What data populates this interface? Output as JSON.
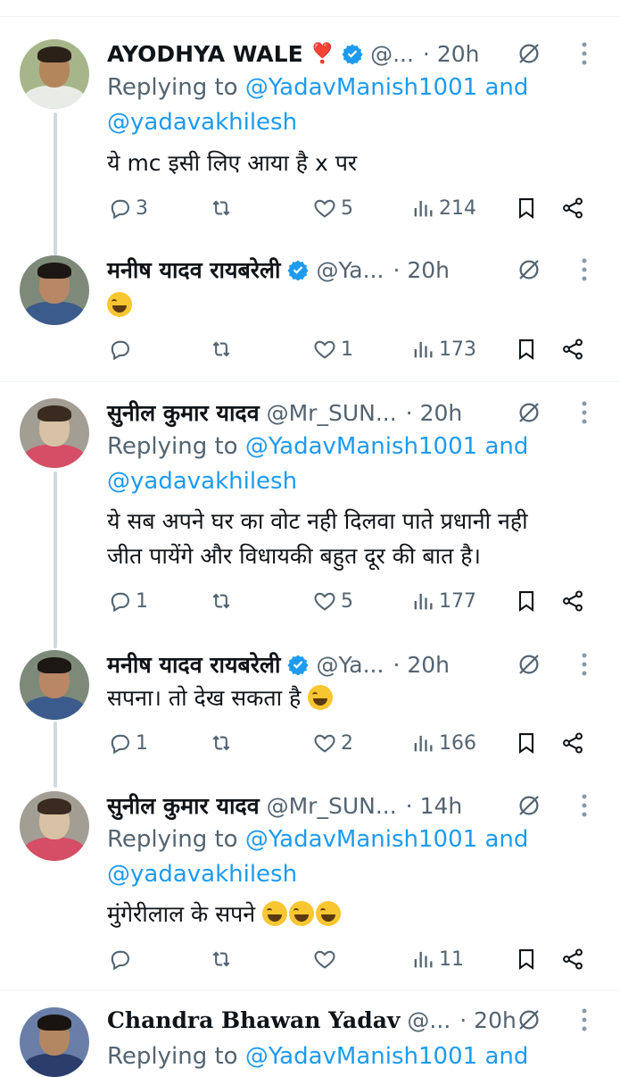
{
  "tweets": [
    {
      "name": "AYODHYA WALE",
      "name_suffix": "❣️",
      "verified": true,
      "handle": "@...",
      "time": "· 20h",
      "replying_prefix": "Replying to ",
      "replying_user1": "@YadavManish1001",
      "replying_and": " and",
      "replying_user2": "@yadavakhilesh",
      "text": "ये mc इसी लिए आया है x पर",
      "replies": "3",
      "retweets": "",
      "likes": "5",
      "views": "214"
    },
    {
      "name": "मनीष यादव रायबरेली",
      "verified": true,
      "handle": "@Ya...",
      "time": "· 20h",
      "text": "",
      "emoji": "laughing-tears",
      "replies": "",
      "retweets": "",
      "likes": "1",
      "views": "173"
    },
    {
      "name": "सुनील कुमार यादव",
      "verified": false,
      "handle": "@Mr_SUN...",
      "time": "· 20h",
      "replying_prefix": "Replying to ",
      "replying_user1": "@YadavManish1001",
      "replying_and": " and",
      "replying_user2": "@yadavakhilesh",
      "text_line1": "ये सब अपने घर का वोट नही दिलवा पाते प्रधानी नही",
      "text_line2": "जीत पायेंगे और विधायकी बहुत दूर की बात है।",
      "replies": "1",
      "retweets": "",
      "likes": "5",
      "views": "177"
    },
    {
      "name": "मनीष यादव रायबरेली",
      "verified": true,
      "handle": "@Ya...",
      "time": "· 20h",
      "text": "सपना। तो देख सकता है",
      "replies": "1",
      "retweets": "",
      "likes": "2",
      "views": "166"
    },
    {
      "name": "सुनील कुमार यादव",
      "verified": false,
      "handle": "@Mr_SUN...",
      "time": "· 14h",
      "replying_prefix": "Replying to ",
      "replying_user1": "@YadavManish1001",
      "replying_and": " and",
      "replying_user2": "@yadavakhilesh",
      "text": "मुंगेरीलाल के सपने",
      "replies": "",
      "retweets": "",
      "likes": "",
      "views": "11"
    },
    {
      "name": "Chandra Bhawan Yadav",
      "verified": false,
      "handle": "@...",
      "time": "· 20h",
      "replying_prefix": "Replying to ",
      "replying_user1": "@YadavManish1001",
      "replying_and": " and"
    }
  ],
  "colors": {
    "accent": "#1d9bf0",
    "muted": "#536471",
    "text": "#0f1419",
    "verified": "#1d9bf0"
  }
}
